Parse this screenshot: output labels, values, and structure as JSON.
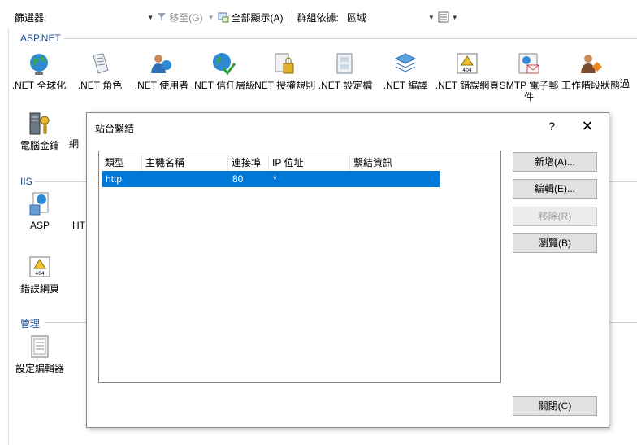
{
  "toolbar": {
    "filter_label": "篩選器:",
    "move_to": "移至(G)",
    "show_all": "全部顯示(A)",
    "group_by_label": "群組依據:",
    "group_by_value": "區域"
  },
  "sections": {
    "aspnet": "ASP.NET",
    "iis": "IIS",
    "management": "管理"
  },
  "features": {
    "net_globalization": ".NET 全球化",
    "net_roles": ".NET 角色",
    "net_users": ".NET 使用者",
    "net_trust_levels": ".NET 信任層級",
    "net_authorization_rules": ".NET 授權規則",
    "net_profile": ".NET 設定檔",
    "net_compilation": ".NET 編譯",
    "net_error_pages": ".NET 錯誤網頁",
    "smtp_email": "SMTP 電子郵件",
    "session_state": "工作階段狀態",
    "machine_key": "電腦金鑰",
    "machine_key_next": "網",
    "asp": "ASP",
    "http_partial": "HT",
    "error_pages": "錯誤網頁",
    "config_editor": "設定編輯器"
  },
  "dialog": {
    "title": "站台繫結",
    "help": "?",
    "close": "✕",
    "columns": [
      "類型",
      "主機名稱",
      "連接埠",
      "IP 位址",
      "繫結資訊"
    ],
    "rows": [
      {
        "type": "http",
        "host": "",
        "port": "80",
        "ip": "*",
        "info": ""
      }
    ],
    "buttons": {
      "add": "新增(A)...",
      "edit": "編輯(E)...",
      "remove": "移除(R)",
      "browse": "瀏覽(B)",
      "close": "關閉(C)"
    }
  },
  "colors": {
    "selection": "#0078d7",
    "section_header": "#1a4b8c"
  }
}
